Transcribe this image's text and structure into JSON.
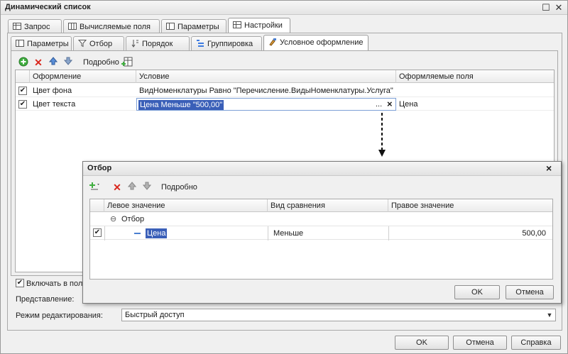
{
  "window": {
    "title": "Динамический список",
    "ok_label": "OK",
    "cancel_label": "Отмена",
    "help_label": "Справка"
  },
  "main_tabs": [
    {
      "label": "Запрос",
      "active": false
    },
    {
      "label": "Вычисляемые поля",
      "active": false
    },
    {
      "label": "Параметры",
      "active": false
    },
    {
      "label": "Настройки",
      "active": true
    }
  ],
  "sub_tabs": [
    {
      "label": "Параметры",
      "active": false
    },
    {
      "label": "Отбор",
      "active": false
    },
    {
      "label": "Порядок",
      "active": false
    },
    {
      "label": "Группировка",
      "active": false
    },
    {
      "label": "Условное оформление",
      "active": true
    }
  ],
  "conditional_toolbar": {
    "details_label": "Подробно"
  },
  "conditional_grid": {
    "columns": [
      "Оформление",
      "Условие",
      "Оформляемые поля"
    ],
    "rows": [
      {
        "checked": true,
        "appearance": "Цвет фона",
        "condition": "ВидНоменклатуры Равно \"Перечисление.ВидыНоменклатуры.Услуга\"",
        "fields": ""
      },
      {
        "checked": true,
        "appearance": "Цвет текста",
        "condition": "Цена Меньше \"500,00\"",
        "fields": "Цена"
      }
    ],
    "ellipsis": "...",
    "clear": "×"
  },
  "bottom": {
    "include_label": "Включать в поль",
    "representation_label": "Представление:",
    "edit_mode_label": "Режим редактирования:",
    "edit_mode_value": "Быстрый доступ"
  },
  "filter_dialog": {
    "title": "Отбор",
    "details_label": "Подробно",
    "columns": [
      "Левое значение",
      "Вид сравнения",
      "Правое значение"
    ],
    "group_label": "Отбор",
    "row": {
      "checked": true,
      "left": "Цена",
      "comparison": "Меньше",
      "right": "500,00"
    },
    "ok_label": "OK",
    "cancel_label": "Отмена",
    "close": "×"
  }
}
